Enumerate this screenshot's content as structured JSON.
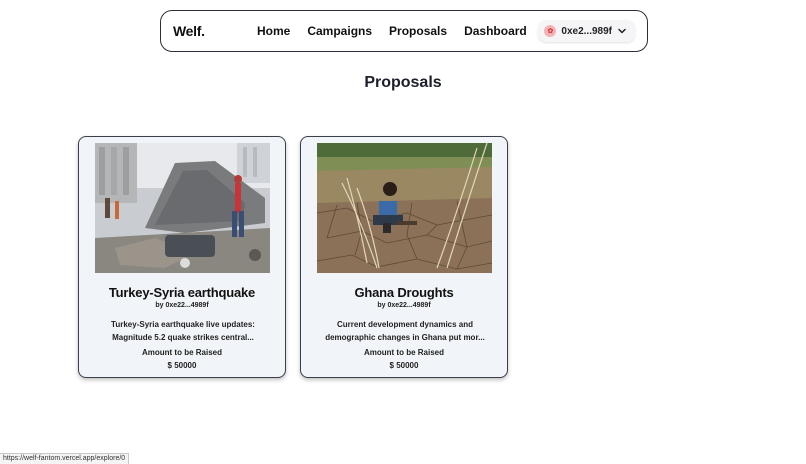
{
  "nav": {
    "logo": "Welf.",
    "links": [
      "Home",
      "Campaigns",
      "Proposals",
      "Dashboard"
    ],
    "wallet": {
      "address": "0xe2...989f",
      "avatar_icon": "user-avatar-icon",
      "dropdown_icon": "chevron-down-icon"
    }
  },
  "page": {
    "title": "Proposals"
  },
  "proposals": [
    {
      "title": "Turkey-Syria earthquake",
      "author": "by 0xe22...4989f",
      "description_line1": "Turkey-Syria earthquake live updates:",
      "description_line2": "Magnitude 5.2 quake strikes central...",
      "raise_label": "Amount to be Raised",
      "amount": "$ 50000"
    },
    {
      "title": "Ghana Droughts",
      "author": "by 0xe22...4989f",
      "description_line1": "Current development dynamics and",
      "description_line2": "demographic changes in Ghana put mor...",
      "raise_label": "Amount to be Raised",
      "amount": "$ 50000"
    }
  ],
  "status_bar": {
    "url": "https://welf-fantom.vercel.app/explore/0"
  },
  "colors": {
    "card_bg": "#f1f4f8",
    "border": "#2a2e38",
    "text": "#1b1f2a"
  }
}
